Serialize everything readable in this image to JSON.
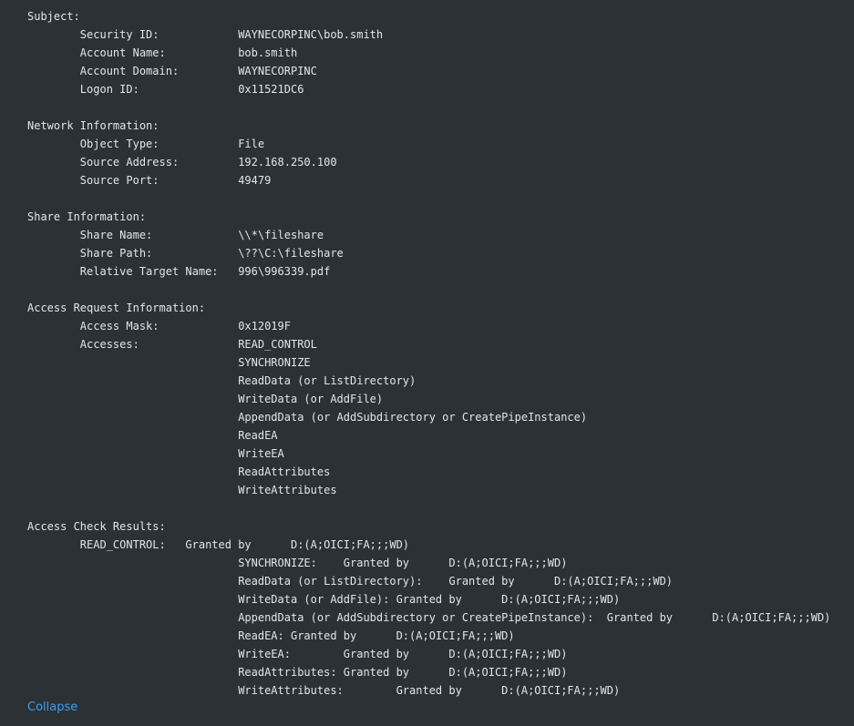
{
  "event_lines": [
    "Subject:",
    "\tSecurity ID:\t\tWAYNECORPINC\\bob.smith",
    "\tAccount Name:\t\tbob.smith",
    "\tAccount Domain:\t\tWAYNECORPINC",
    "\tLogon ID:\t\t0x11521DC6",
    "",
    "Network Information:",
    "\tObject Type:\t\tFile",
    "\tSource Address:\t\t192.168.250.100",
    "\tSource Port:\t\t49479",
    "",
    "Share Information:",
    "\tShare Name:\t\t\\\\*\\fileshare",
    "\tShare Path:\t\t\\??\\C:\\fileshare",
    "\tRelative Target Name:\t996\\996339.pdf",
    "",
    "Access Request Information:",
    "\tAccess Mask:\t\t0x12019F",
    "\tAccesses:\t\tREAD_CONTROL",
    "\t\t\t\tSYNCHRONIZE",
    "\t\t\t\tReadData (or ListDirectory)",
    "\t\t\t\tWriteData (or AddFile)",
    "\t\t\t\tAppendData (or AddSubdirectory or CreatePipeInstance)",
    "\t\t\t\tReadEA",
    "\t\t\t\tWriteEA",
    "\t\t\t\tReadAttributes",
    "\t\t\t\tWriteAttributes",
    "",
    "Access Check Results:",
    "\tREAD_CONTROL:\tGranted by\tD:(A;OICI;FA;;;WD)",
    "\t\t\t\tSYNCHRONIZE:\tGranted by\tD:(A;OICI;FA;;;WD)",
    "\t\t\t\tReadData (or ListDirectory):\tGranted by\tD:(A;OICI;FA;;;WD)",
    "\t\t\t\tWriteData (or AddFile):\tGranted by\tD:(A;OICI;FA;;;WD)",
    "\t\t\t\tAppendData (or AddSubdirectory or CreatePipeInstance):\tGranted by\tD:(A;OICI;FA;;;WD)",
    "\t\t\t\tReadEA:\tGranted by\tD:(A;OICI;FA;;;WD)",
    "\t\t\t\tWriteEA:\tGranted by\tD:(A;OICI;FA;;;WD)",
    "\t\t\t\tReadAttributes:\tGranted by\tD:(A;OICI;FA;;;WD)",
    "\t\t\t\tWriteAttributes:\tGranted by\tD:(A;OICI;FA;;;WD)"
  ],
  "collapse_label": "Collapse",
  "colors": {
    "background": "#2b3134",
    "text": "#e3e6e8",
    "link": "#3b9ff0"
  }
}
